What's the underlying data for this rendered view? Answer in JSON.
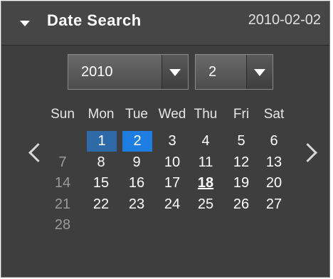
{
  "header": {
    "title": "Date Search",
    "date": "2010-02-02"
  },
  "selectors": {
    "year": "2010",
    "month": "2"
  },
  "weekdays": [
    "Sun",
    "Mon",
    "Tue",
    "Wed",
    "Thu",
    "Fri",
    "Sat"
  ],
  "weeks": [
    [
      "",
      "1",
      "2",
      "3",
      "4",
      "5",
      "6"
    ],
    [
      "7",
      "8",
      "9",
      "10",
      "11",
      "12",
      "13"
    ],
    [
      "14",
      "15",
      "16",
      "17",
      "18",
      "19",
      "20"
    ],
    [
      "21",
      "22",
      "23",
      "24",
      "25",
      "26",
      "27"
    ],
    [
      "28",
      "",
      "",
      "",
      "",
      "",
      ""
    ]
  ],
  "highlighted_days": [
    "1",
    "2"
  ],
  "today": "18",
  "disabled_days": [
    "7",
    "14",
    "21",
    "28"
  ],
  "colors": {
    "panel_bg": "#3e3e3e",
    "selection_primary": "#1e7de0",
    "selection_secondary": "#2f6aa8",
    "disabled_text": "#9a9a9a"
  },
  "icons": {
    "collapse": "triangle-down-icon",
    "dropdown": "triangle-down-icon",
    "prev": "chevron-left-icon",
    "next": "chevron-right-icon"
  }
}
